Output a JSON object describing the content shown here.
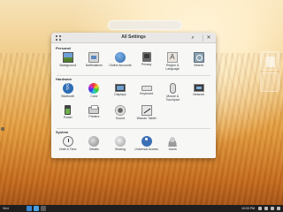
{
  "window": {
    "title": "All Settings"
  },
  "sections": [
    {
      "title": "Personal",
      "items": [
        {
          "label": "Background",
          "icon": "background-icon"
        },
        {
          "label": "Notifications",
          "icon": "notifications-icon"
        },
        {
          "label": "Online Accounts",
          "icon": "online-accounts-icon"
        },
        {
          "label": "Privacy",
          "icon": "privacy-icon"
        },
        {
          "label": "Region & Language",
          "icon": "region-language-icon"
        },
        {
          "label": "Search",
          "icon": "search-settings-icon"
        }
      ]
    },
    {
      "title": "Hardware",
      "items": [
        {
          "label": "Bluetooth",
          "icon": "bluetooth-icon"
        },
        {
          "label": "Color",
          "icon": "color-icon"
        },
        {
          "label": "Displays",
          "icon": "displays-icon"
        },
        {
          "label": "Keyboard",
          "icon": "keyboard-icon"
        },
        {
          "label": "Mouse & Touchpad",
          "icon": "mouse-icon"
        },
        {
          "label": "Network",
          "icon": "network-icon"
        },
        {
          "label": "Power",
          "icon": "power-icon"
        },
        {
          "label": "Printers",
          "icon": "printers-icon"
        },
        {
          "label": "Sound",
          "icon": "sound-icon"
        },
        {
          "label": "Wacom Tablet",
          "icon": "wacom-tablet-icon"
        }
      ]
    },
    {
      "title": "System",
      "items": [
        {
          "label": "Date & Time",
          "icon": "date-time-icon"
        },
        {
          "label": "Details",
          "icon": "details-icon"
        },
        {
          "label": "Sharing",
          "icon": "sharing-icon"
        },
        {
          "label": "Universal Access",
          "icon": "universal-access-icon"
        },
        {
          "label": "Users",
          "icon": "users-icon"
        }
      ]
    }
  ],
  "panel": {
    "left_text": "Wed",
    "clock": "10:03 PM"
  }
}
